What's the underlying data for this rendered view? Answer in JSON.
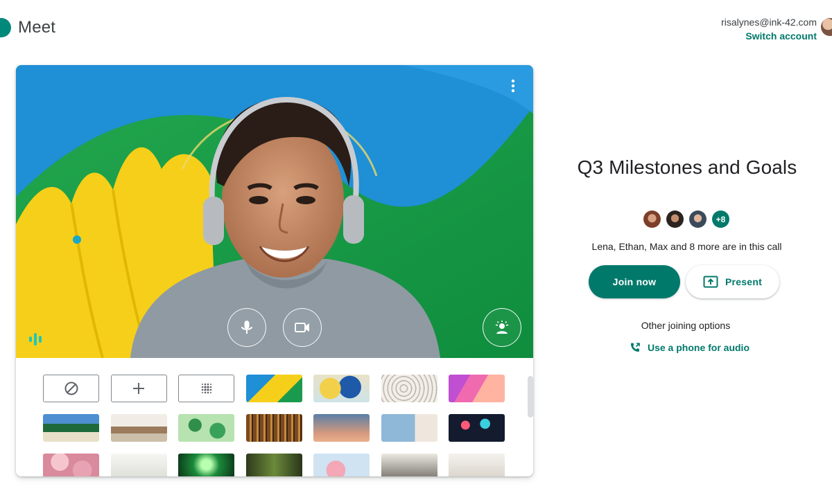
{
  "app": {
    "name": "Meet"
  },
  "account": {
    "email": "risalynes@ink-42.com",
    "switch_label": "Switch account"
  },
  "preview": {
    "controls": [
      "more-options",
      "microphone",
      "camera",
      "visual-effects"
    ],
    "audio_indicator": "audio-level-icon",
    "backgrounds": {
      "options": [
        "no-effect",
        "add-background",
        "blur"
      ],
      "thumbnails": [
        "abstract-yellow-blue",
        "abstract-shapes",
        "sketch-lines",
        "purple-plants",
        "tropical-beach",
        "horses",
        "green-leaves",
        "bookshelf",
        "sunset-sky",
        "coastal-view",
        "fireworks",
        "pink-flowers",
        "bright-room",
        "green-lights",
        "forest",
        "blossoms",
        "dark-room",
        "kitchen"
      ]
    }
  },
  "meeting": {
    "title": "Q3 Milestones and Goals",
    "participants_more": "+8",
    "in_call_text": "Lena, Ethan, Max and 8 more are in this call",
    "join_label": "Join now",
    "present_label": "Present",
    "other_options_label": "Other joining options",
    "phone_audio_label": "Use a phone for audio"
  },
  "colors": {
    "accent": "#00796b",
    "brand": "#00897b"
  }
}
